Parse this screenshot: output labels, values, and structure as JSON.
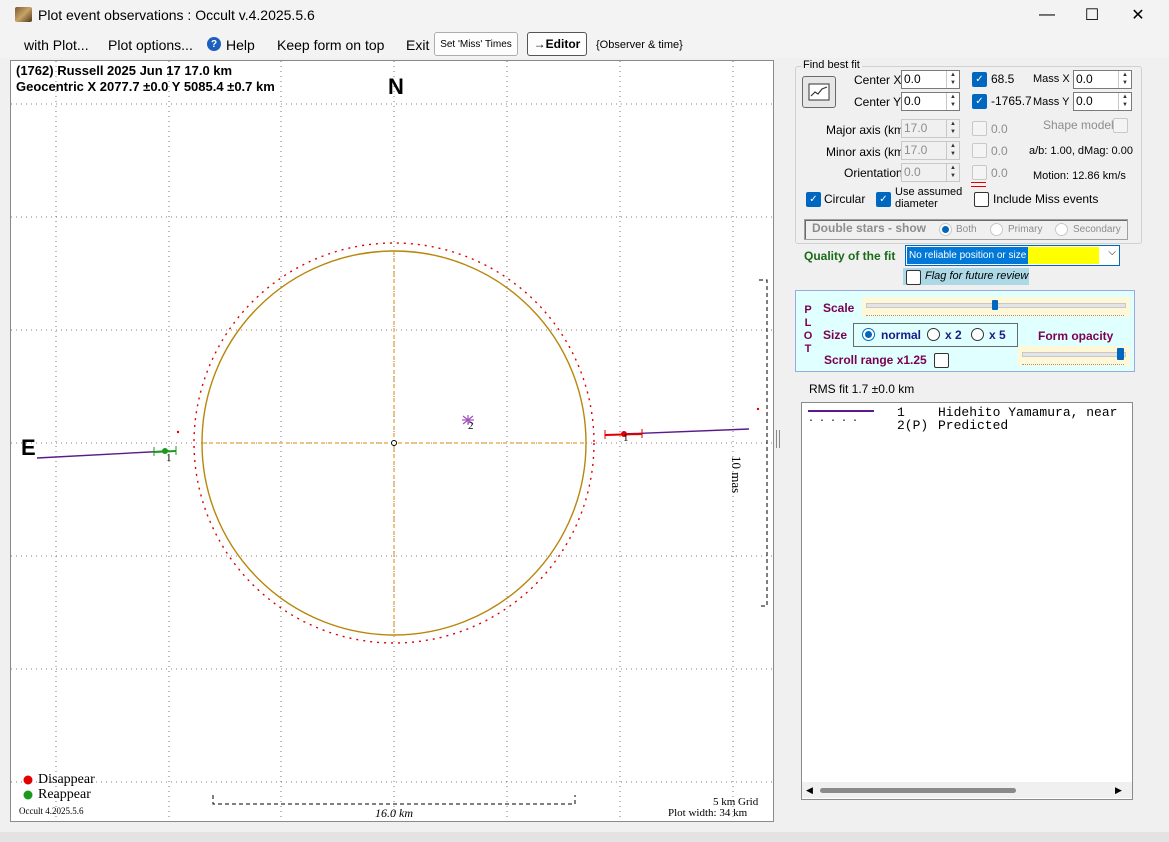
{
  "window": {
    "title": "Plot event observations : Occult v.4.2025.5.6",
    "controls": {
      "minimize": "—",
      "maximize": "☐",
      "close": "✕"
    }
  },
  "menu": {
    "with_plot": "with Plot...",
    "plot_options": "Plot options...",
    "help": "Help",
    "keep_on_top": "Keep form on top",
    "exit": "Exit",
    "set_miss_times": "Set 'Miss' Times",
    "editor": "→Editor",
    "observer_time": "{Observer & time}"
  },
  "plot": {
    "header_line1": "(1762) Russell  2025 Jun 17  17.0 km",
    "header_line2": "Geocentric  X  2077.7 ±0.0  Y 5085.4 ±0.7 km",
    "north_label": "N",
    "east_label": "E",
    "chord_1_label": "1",
    "chord_2_label": "2",
    "mas_label": "10 mas",
    "legend_disappear": "Disappear",
    "legend_reappear": "Reappear",
    "version_footer": "Occult 4.2025.5.6",
    "scale_bar_label": "16.0 km",
    "grid_label": "5 km Grid",
    "plot_width": "Plot width: 34 km",
    "colors": {
      "disappear": "#e00000",
      "reappear": "#1a9a1a",
      "ellipse": "#b8860b",
      "predicted": "#e00000",
      "chord": "#5a1a8a"
    }
  },
  "fit": {
    "group_title": "Find best fit",
    "center_x_label": "Center X",
    "center_x_value": "0.0",
    "center_y_label": "Center Y",
    "center_y_value": "0.0",
    "center_x_fit": "68.5",
    "center_y_fit": "-1765.7",
    "mass_x_label": "Mass X",
    "mass_x_value": "0.0",
    "mass_y_label": "Mass Y",
    "mass_y_value": "0.0",
    "major_axis_label": "Major axis (km)",
    "major_axis_value": "17.0",
    "major_axis_fit": "0.0",
    "minor_axis_label": "Minor axis (km)",
    "minor_axis_value": "17.0",
    "minor_axis_fit": "0.0",
    "orientation_label": "Orientation",
    "orientation_value": "0.0",
    "orientation_fit": "0.0",
    "shape_model_label": "Shape model",
    "ab_dmag": "a/b: 1.00, dMag: 0.00",
    "motion": "Motion: 12.86 km/s",
    "circular_label": "Circular",
    "use_assumed_label": "Use assumed diameter",
    "include_miss_label": "Include Miss events",
    "double_stars_label": "Double stars - show",
    "ds_both": "Both",
    "ds_primary": "Primary",
    "ds_secondary": "Secondary",
    "quality_label": "Quality of the fit",
    "quality_value": "No reliable position or size",
    "flag_review_label": "Flag for future review"
  },
  "plot_controls": {
    "side_letters": [
      "P",
      "L",
      "O",
      "T"
    ],
    "scale_label": "Scale",
    "scale_level": 0.5,
    "size_label": "Size",
    "size_normal": "normal",
    "size_x2": "x 2",
    "size_x5": "x 5",
    "form_opacity_label": "Form opacity",
    "opacity_level": 1.0,
    "scroll_range_label": "Scroll range x1.25"
  },
  "rms": "RMS fit 1.7 ±0.0 km",
  "observers": [
    {
      "num": "1",
      "name": "Hidehito Yamamura, near"
    },
    {
      "num": "2(P)",
      "name": "Predicted"
    }
  ]
}
